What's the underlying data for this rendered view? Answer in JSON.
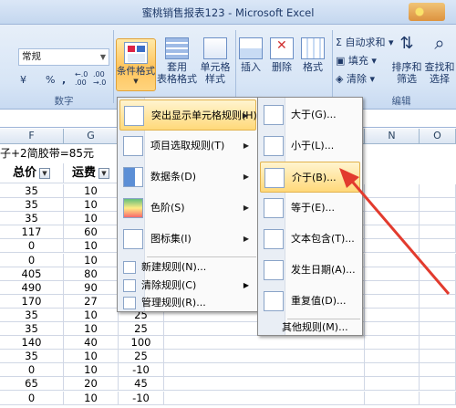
{
  "window": {
    "title": "蜜桃销售报表123 - Microsoft Excel"
  },
  "ribbon": {
    "number_format": {
      "value": "常规"
    },
    "number_buttons": {
      "percent": "%",
      "comma": ",",
      "inc_decimal": "←.0 .00",
      "dec_decimal": ".00 →.0",
      "currency": "¥"
    },
    "group_number": "数字",
    "conditional_format": "条件格式",
    "table_format": {
      "line1": "套用",
      "line2": "表格格式"
    },
    "cell_style": {
      "line1": "单元格",
      "line2": "样式"
    },
    "insert": "插入",
    "delete": "删除",
    "format": "格式",
    "autosum": "自动求和",
    "fill": "填充",
    "clear": "清除",
    "sort_filter": {
      "line1": "排序和",
      "line2": "筛选"
    },
    "find_select": {
      "line1": "查找和",
      "line2": "选择"
    },
    "group_edit": "编辑"
  },
  "grid": {
    "col_headers": [
      "F",
      "G",
      "",
      "",
      "N",
      "O"
    ],
    "note": "子+2简胶带=85元",
    "header_row": [
      "总价",
      "运费"
    ],
    "rows": [
      [
        "35",
        "10",
        ""
      ],
      [
        "35",
        "10",
        ""
      ],
      [
        "35",
        "10",
        ""
      ],
      [
        "117",
        "60",
        ""
      ],
      [
        "0",
        "10",
        ""
      ],
      [
        "0",
        "10",
        ""
      ],
      [
        "405",
        "80",
        ""
      ],
      [
        "490",
        "90",
        ""
      ],
      [
        "170",
        "27",
        "143"
      ],
      [
        "35",
        "10",
        "25"
      ],
      [
        "35",
        "10",
        "25"
      ],
      [
        "140",
        "40",
        "100"
      ],
      [
        "35",
        "10",
        "25"
      ],
      [
        "0",
        "10",
        "-10"
      ],
      [
        "65",
        "20",
        "45"
      ],
      [
        "0",
        "10",
        "-10"
      ]
    ]
  },
  "cf_menu": {
    "items": [
      {
        "label": "突出显示单元格规则(H)",
        "icon": "highlight-rules-icon"
      },
      {
        "label": "项目选取规则(T)",
        "icon": "top-bottom-rules-icon"
      },
      {
        "label": "数据条(D)",
        "icon": "data-bars-icon"
      },
      {
        "label": "色阶(S)",
        "icon": "color-scales-icon"
      },
      {
        "label": "图标集(I)",
        "icon": "icon-sets-icon"
      }
    ],
    "small_items": [
      {
        "label": "新建规则(N)...",
        "icon": "new-rule-icon"
      },
      {
        "label": "清除规则(C)",
        "icon": "clear-rules-icon"
      },
      {
        "label": "管理规则(R)...",
        "icon": "manage-rules-icon"
      }
    ]
  },
  "submenu": {
    "items": [
      {
        "label": "大于(G)...",
        "icon": "greater-than-icon"
      },
      {
        "label": "小于(L)...",
        "icon": "less-than-icon"
      },
      {
        "label": "介于(B)...",
        "icon": "between-icon"
      },
      {
        "label": "等于(E)...",
        "icon": "equal-to-icon"
      },
      {
        "label": "文本包含(T)...",
        "icon": "text-contains-icon"
      },
      {
        "label": "发生日期(A)...",
        "icon": "date-occurring-icon"
      },
      {
        "label": "重复值(D)...",
        "icon": "duplicate-values-icon"
      }
    ],
    "more": "其他规则(M)..."
  },
  "colors": {
    "arrow": "#e23b2e",
    "highlight": "#ffd97a"
  }
}
